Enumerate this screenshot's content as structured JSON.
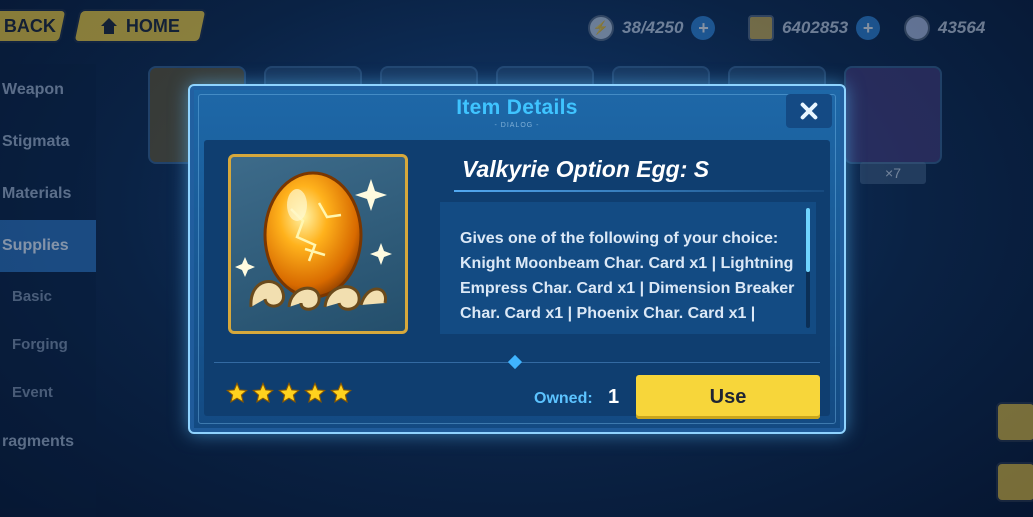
{
  "topbar": {
    "back_label": "BACK",
    "home_label": "HOME",
    "stamina": "38/4250",
    "coins": "6402853",
    "crystals": "43564",
    "plus": "+"
  },
  "sidebar": {
    "items": [
      "Weapon",
      "Stigmata",
      "Materials",
      "Supplies",
      "Basic",
      "Forging",
      "Event",
      "ragments"
    ]
  },
  "background": {
    "count_badge": "×7"
  },
  "dialog": {
    "title": "Item Details",
    "subtitle": "- DIALOG -",
    "item_name": "Valkyrie Option Egg: S",
    "description": "Gives one of the following of your choice: Knight Moonbeam Char. Card x1 | Lightning Empress Char. Card x1 | Dimension Breaker Char. Card x1 | Phoenix Char. Card x1 |",
    "stars": 5,
    "owned_label": "Owned:",
    "owned_value": "1",
    "use_label": "Use"
  },
  "colors": {
    "accent_blue": "#3fc4ff",
    "button_yellow": "#f7d63a",
    "star_gold": "#ffd21e",
    "dialog_bg": "#134a82"
  },
  "icons": [
    "home-icon",
    "stamina-icon",
    "coin-icon",
    "crystal-icon",
    "plus-icon",
    "close-icon",
    "egg-item-icon",
    "star-icon"
  ]
}
